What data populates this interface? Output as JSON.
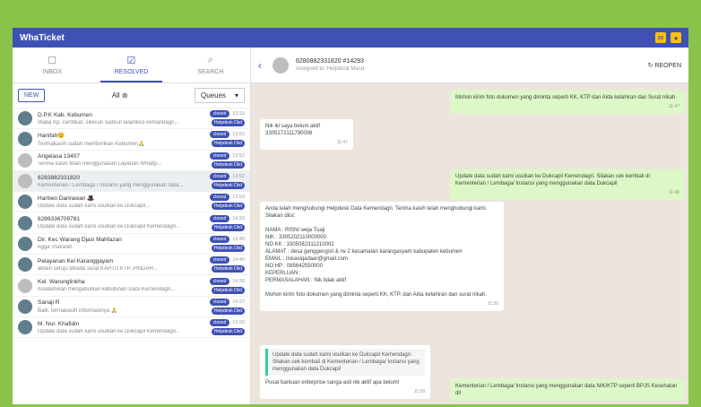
{
  "app": {
    "title": "WhaTicket"
  },
  "tabs": [
    {
      "label": "INBOX",
      "icon": "inbox-icon"
    },
    {
      "label": "RESOLVED",
      "icon": "check-box-icon"
    },
    {
      "label": "SEARCH",
      "icon": "search-icon"
    }
  ],
  "filter": {
    "new_label": "NEW",
    "middle_label": "All",
    "queue_label": "Queues"
  },
  "tickets": [
    {
      "name": "D.P.K Kab. Kebumen",
      "msg": "Waba Kp. certifikat, silikcun sudkun lalamkos kemandagri...",
      "time": "13:10",
      "status": "closed",
      "queue": "Helpdesk Dkd"
    },
    {
      "name": "Hanifah😊",
      "msg": "Terimakasih sudah memberikan Kebumen🙏",
      "time": "13:52",
      "status": "closed",
      "queue": "Helpdesk Dkd"
    },
    {
      "name": "Angelasa 13407",
      "msg": "Terima kasih telah menggunakan Layanan Whattp...",
      "time": "13:52",
      "status": "closed",
      "queue": "Helpdesk Dkd"
    },
    {
      "name": "6283882331820",
      "msg": "Kementerian / Lembaga / Instansi yang menggunakan data...",
      "time": "13:52",
      "status": "closed",
      "queue": "Helpdesk Dkd"
    },
    {
      "name": "Hartiwo Darirawan 🎩",
      "msg": "Update data sudah kami usulkan ke Dukcapil...",
      "time": "13:50",
      "status": "closed",
      "queue": "Helpdesk Dkd"
    },
    {
      "name": "6289336709781",
      "msg": "Update data sudah kami usulkan ke Dukcapil Kemendagri...",
      "time": "14:33",
      "status": "closed",
      "queue": "Helpdesk Dkd"
    },
    {
      "name": "Dir. Kec Warang Djasi Mahfazan",
      "msg": "ngga' makasih.",
      "time": "14:40",
      "status": "closed",
      "queue": "Helpdesk Dkd"
    },
    {
      "name": "Pelayanan Kel Karanggayam",
      "msg": "aktain setuju tdkada surat KARTU KTP, PINDAH...",
      "time": "14:40",
      "status": "closed",
      "queue": "Helpdesk Dkd"
    },
    {
      "name": "Kel. Warunglinkha",
      "msg": "Aslalamikan mengabulkan kebutuhan Data Kemendagri...",
      "time": "14:30",
      "status": "closed",
      "queue": "Helpdesk Dkd"
    },
    {
      "name": "Sanaji R",
      "msg": "Baik, termakasih informasinya 🙏",
      "time": "14:22",
      "status": "closed",
      "queue": "Helpdesk Dkd"
    },
    {
      "name": "M. Nur. Khafidin",
      "msg": "Update data sudah kami usulkan ke Dukcapil Kemendagri...",
      "time": "13:50",
      "status": "closed",
      "queue": "Helpdesk Dkd"
    }
  ],
  "chat": {
    "contact_name": "6280882331820 #14293",
    "contact_sub": "Assigned to: Helpdesk Masd",
    "reopen_label": "REOPEN",
    "messages": [
      {
        "dir": "out",
        "text": "Mohon kirim foto dokumen yang diminta seperti KK, KTP dan Akta kelahiran dan Surat nikah.",
        "time": "11:47"
      },
      {
        "dir": "in",
        "text": "Nik iki saya belum aktif\n3305172111790006",
        "time": "11:47"
      },
      {
        "dir": "out",
        "text": "Update data sudah kami usulkan ke Dukcapil Kemendagri. Silakan cek kembali di Kementerian / Lembaga/ Instansi yang menggunakan data Dukcapil",
        "time": "11:48"
      },
      {
        "dir": "in",
        "text": "Anda telah menghubungi Helpdesk Data Kemendagri. Terima kasih telah menghubungi kami.\nSilakan diisi:\n\nNAMA : RISNI weja Tuaji\nNIK : 3305202110000000\nNO KK : 3305082311210002\nALAMAT : desa genggengsri & rw 2 kecamatan karangasyam kabupaten kebumen\nEMAIL : riskasiqadaar@gmail.com\nNO HP : 085642550000\nKEPERLUAN :\nPERMASALAHAN : Nik tidak aktif\n\nMohon kirim foto dokumen yang diminta seperti KK, KTP, dan Akta kelahiran dan surat nikah.",
        "time": "11:50"
      },
      {
        "dir": "in",
        "quote": "Update data sudah kami usulkan ke Dukcapil Kemendagri. Silakan cek kembali di Kementerian / Lembaga/ Instansi yang menggunakan data Dukcapil",
        "text": "Pusat bantuan enterprise sanga asit nik aktif apa belum!",
        "time": "11:58"
      },
      {
        "dir": "out",
        "text": "Kementerian / Lembaga/ Instansi yang menggunakan data NIK/KTP seperti BPJS Kesehatan dll",
        "time": ""
      }
    ]
  },
  "colors": {
    "primary": "#3f51b5",
    "border": "#8bc34a",
    "chat_bg": "#ece5dd",
    "bubble_out": "#dcf8c6"
  }
}
